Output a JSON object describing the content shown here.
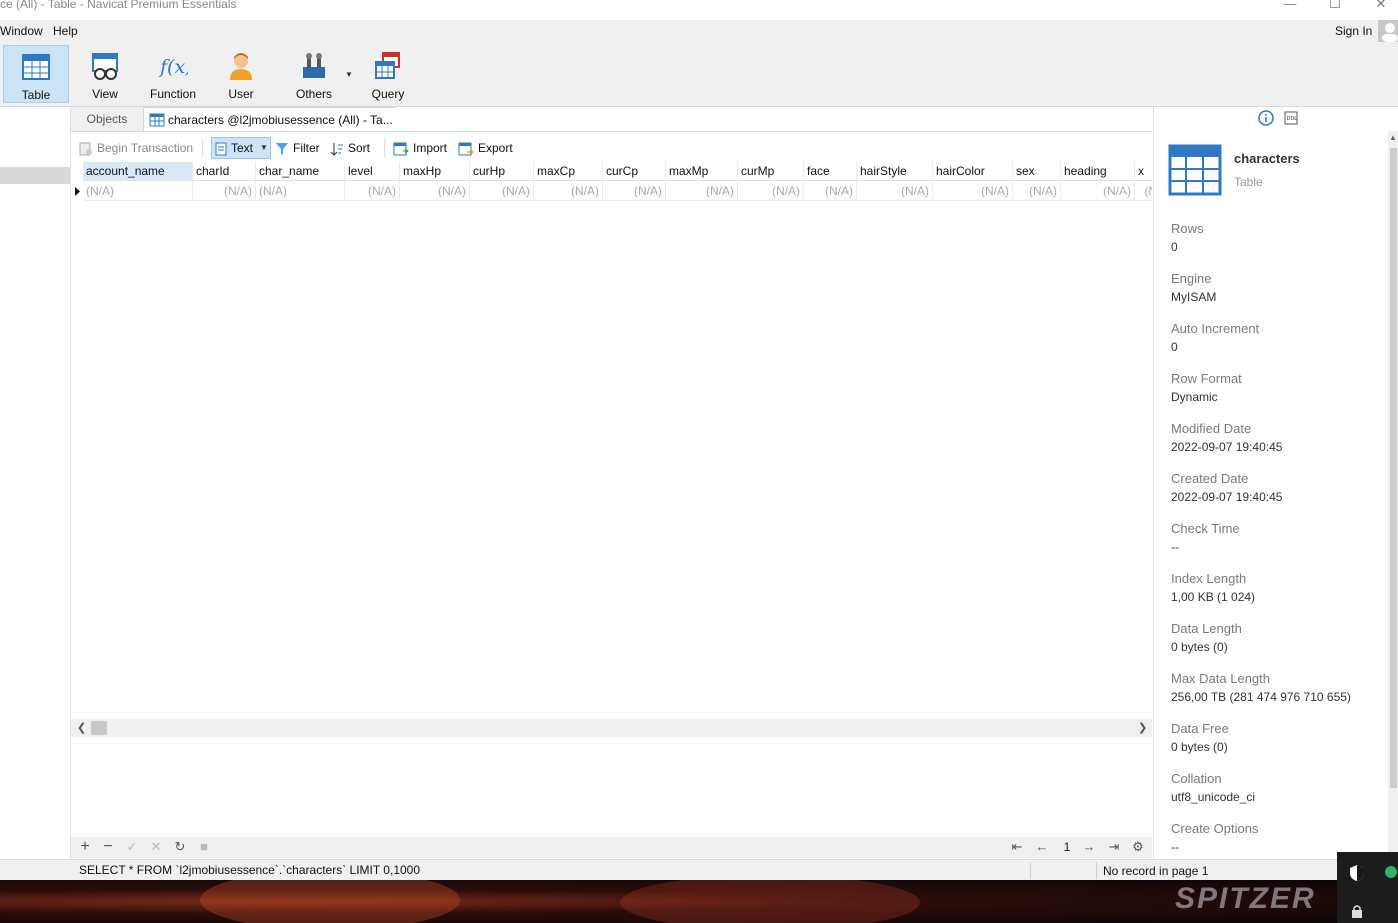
{
  "window": {
    "title": "ce (All) - Table - Navicat Premium Essentials",
    "sign_in": "Sign In"
  },
  "menubar": [
    "Window",
    "Help"
  ],
  "toolbar": [
    {
      "label": "Table",
      "icon": "table-icon",
      "active": true
    },
    {
      "label": "View",
      "icon": "view-icon"
    },
    {
      "label": "Function",
      "icon": "function-icon"
    },
    {
      "label": "User",
      "icon": "user-icon"
    },
    {
      "label": "Others",
      "icon": "others-icon"
    },
    {
      "label": "Query",
      "icon": "query-icon"
    }
  ],
  "tabs": {
    "objects": "Objects",
    "active": "characters @l2jmobiusessence (All) - Ta..."
  },
  "grid_toolbar": {
    "begin_transaction": "Begin Transaction",
    "text": "Text",
    "filter": "Filter",
    "sort": "Sort",
    "import": "Import",
    "export": "Export"
  },
  "grid": {
    "columns": [
      "account_name",
      "charId",
      "char_name",
      "level",
      "maxHp",
      "curHp",
      "maxCp",
      "curCp",
      "maxMp",
      "curMp",
      "face",
      "hairStyle",
      "hairColor",
      "sex",
      "heading",
      "x"
    ],
    "row": [
      "(N/A)",
      "(N/A)",
      "(N/A)",
      "(N/A)",
      "(N/A)",
      "(N/A)",
      "(N/A)",
      "(N/A)",
      "(N/A)",
      "(N/A)",
      "(N/A)",
      "(N/A)",
      "(N/A)",
      "(N/A)",
      "(N/A)",
      "(N"
    ]
  },
  "pager": {
    "page": "1"
  },
  "status": {
    "sql": "SELECT * FROM `l2jmobiusessence`.`characters` LIMIT 0,1000",
    "records": "No record in page 1"
  },
  "info": {
    "name": "characters",
    "type": "Table",
    "fields": [
      {
        "label": "Rows",
        "value": "0"
      },
      {
        "label": "Engine",
        "value": "MyISAM"
      },
      {
        "label": "Auto Increment",
        "value": "0"
      },
      {
        "label": "Row Format",
        "value": "Dynamic"
      },
      {
        "label": "Modified Date",
        "value": "2022-09-07 19:40:45"
      },
      {
        "label": "Created Date",
        "value": "2022-09-07 19:40:45"
      },
      {
        "label": "Check Time",
        "value": "--"
      },
      {
        "label": "Index Length",
        "value": "1,00 KB (1 024)"
      },
      {
        "label": "Data Length",
        "value": "0 bytes (0)"
      },
      {
        "label": "Max Data Length",
        "value": "256,00 TB (281 474 976 710 655)"
      },
      {
        "label": "Data Free",
        "value": "0 bytes (0)"
      },
      {
        "label": "Collation",
        "value": "utf8_unicode_ci"
      },
      {
        "label": "Create Options",
        "value": "--"
      }
    ]
  },
  "desktop": {
    "watermark": "SPITZER"
  },
  "colors": {
    "accent": "#cce4f7",
    "panel": "#f0f0f0"
  }
}
